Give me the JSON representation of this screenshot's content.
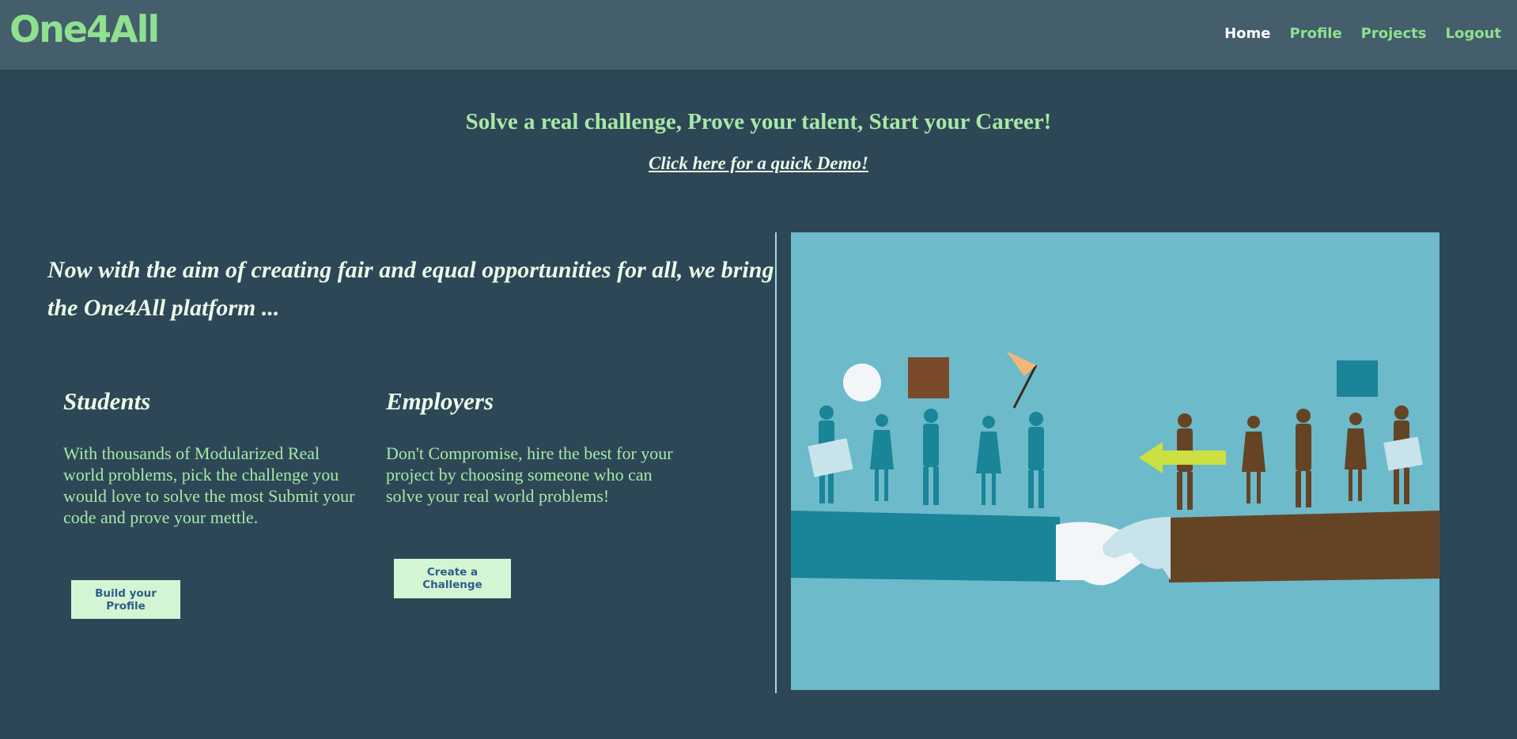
{
  "navbar": {
    "brand": "One4All",
    "links": [
      {
        "label": "Home",
        "active": true
      },
      {
        "label": "Profile"
      },
      {
        "label": "Projects"
      },
      {
        "label": "Logout"
      }
    ]
  },
  "hero": {
    "tagline": "Solve a real challenge, Prove your talent, Start your Career!",
    "demo_link": "Click here for a quick Demo!"
  },
  "intro": {
    "text": "Now with the aim of creating fair and equal opportunities for all, we bring the One4All platform ..."
  },
  "students": {
    "heading": "Students",
    "description": "With thousands of Modularized Real world problems, pick the challenge you would love to solve the most Submit your code and prove your mettle.",
    "button_label": "Build your Profile"
  },
  "employers": {
    "heading": "Employers",
    "description": "Don't Compromise, hire the best for your project by choosing someone who can solve your real world problems!",
    "button_label": "Create a Challenge"
  },
  "illustration": {
    "icon": "teams-handshake-illustration",
    "colors": {
      "background": "#6dbacb",
      "teal": "#1a8499",
      "brown": "#654425",
      "hand_light": "#f2f6f8",
      "accent_orange": "#f2b57a",
      "arrow_yellow": "#cde041"
    }
  },
  "colors": {
    "page_bg": "#2e4756",
    "navbar_bg": "#445e6c",
    "accent_green": "#8fe08f",
    "text_light": "#eaf9ea",
    "button_bg": "#d4f5d4",
    "button_text": "#2e5d8a"
  }
}
